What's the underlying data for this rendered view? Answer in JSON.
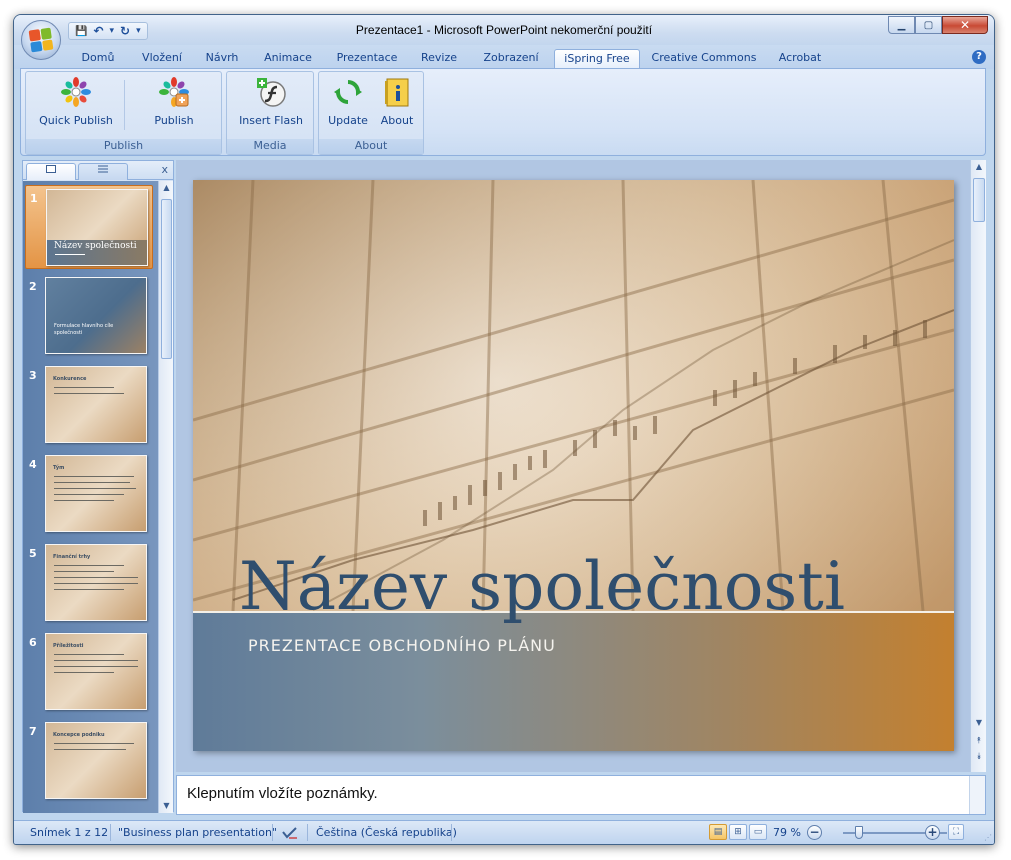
{
  "window": {
    "title": "Prezentace1 - Microsoft PowerPoint nekomerční použití",
    "controls": {
      "minimize": "▁",
      "maximize": "▢",
      "close": "✕"
    }
  },
  "qat": {
    "save": "💾",
    "undo": "↶",
    "undo_more": "▾",
    "redo": "↻",
    "customize": "▾"
  },
  "tabs": [
    {
      "label": "Domů"
    },
    {
      "label": "Vložení"
    },
    {
      "label": "Návrh"
    },
    {
      "label": "Animace"
    },
    {
      "label": "Prezentace"
    },
    {
      "label": "Revize"
    },
    {
      "label": "Zobrazení"
    },
    {
      "label": "iSpring Free"
    },
    {
      "label": "Creative Commons"
    },
    {
      "label": "Acrobat"
    }
  ],
  "help_label": "?",
  "ribbon": {
    "groups": [
      {
        "label": "Publish",
        "buttons": [
          {
            "label": "Quick Publish",
            "icon": "quick-publish-icon"
          },
          {
            "label": "Publish",
            "icon": "publish-icon"
          }
        ]
      },
      {
        "label": "Media",
        "buttons": [
          {
            "label": "Insert Flash",
            "icon": "insert-flash-icon"
          }
        ]
      },
      {
        "label": "About",
        "buttons": [
          {
            "label": "Update",
            "icon": "update-icon"
          },
          {
            "label": "About",
            "icon": "about-icon"
          }
        ]
      }
    ]
  },
  "slides_pane": {
    "close": "x",
    "slides": [
      {
        "number": "1",
        "title": "Název společnosti"
      },
      {
        "number": "2",
        "title": "Formulace hlavního cíle společnosti"
      },
      {
        "number": "3",
        "title": "Konkurence"
      },
      {
        "number": "4",
        "title": "Tým"
      },
      {
        "number": "5",
        "title": "Finanční trhy"
      },
      {
        "number": "6",
        "title": "Příležitosti"
      },
      {
        "number": "7",
        "title": "Koncepce podniku"
      }
    ]
  },
  "slide": {
    "title": "Název společnosti",
    "subtitle": "PREZENTACE OBCHODNÍHO PLÁNU"
  },
  "notes": {
    "placeholder": "Klepnutím vložíte poznámky."
  },
  "status": {
    "slide_counter": "Snímek 1 z 12",
    "theme": "\"Business plan presentation\"",
    "language": "Čeština (Česká republika)",
    "zoom": "79 %",
    "zoom_minus": "−",
    "zoom_plus": "+"
  },
  "colors": {
    "accent": "#15428b",
    "active_view": "#f5c565"
  }
}
